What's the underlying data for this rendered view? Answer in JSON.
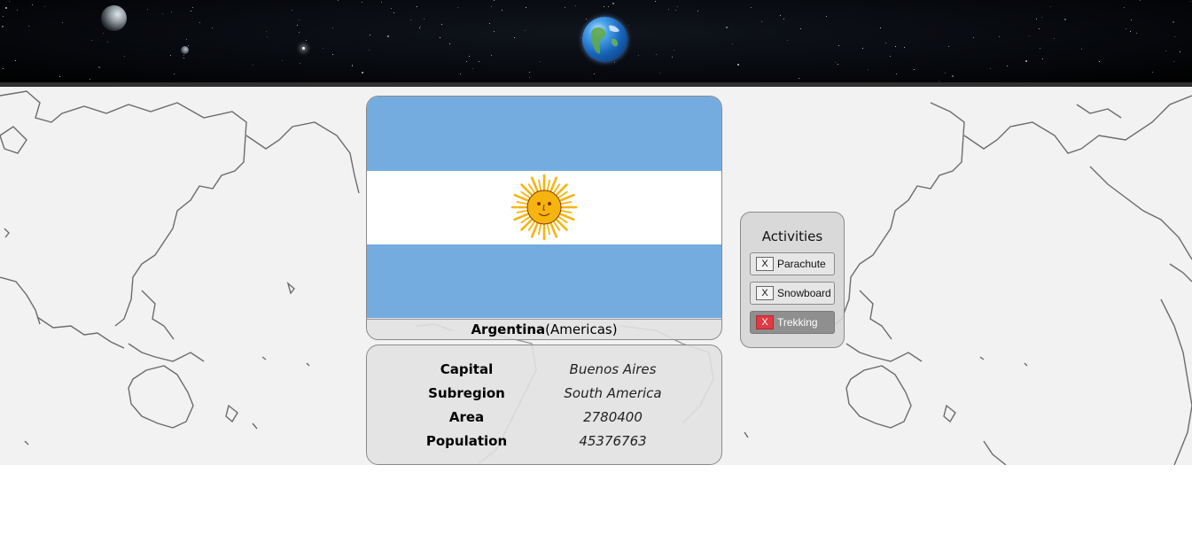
{
  "country": {
    "name": "Argentina",
    "region_text": "(Americas)",
    "flag_colors": {
      "stripe_blue": "#74acdf",
      "stripe_white": "#ffffff",
      "sun": "#f6b40e",
      "sun_outline": "#85340a"
    }
  },
  "details": {
    "rows": [
      {
        "label": "Capital",
        "value": "Buenos Aires"
      },
      {
        "label": "Subregion",
        "value": "South America"
      },
      {
        "label": "Area",
        "value": "2780400"
      },
      {
        "label": "Population",
        "value": "45376763"
      }
    ]
  },
  "activities": {
    "title": "Activities",
    "items": [
      {
        "remove_glyph": "X",
        "label": "Parachute",
        "selected": false
      },
      {
        "remove_glyph": "X",
        "label": "Snowboard",
        "selected": false
      },
      {
        "remove_glyph": "X",
        "label": "Trekking",
        "selected": true
      }
    ]
  },
  "header": {
    "icons": [
      "globe-icon",
      "moon-icon",
      "small-planet-icon"
    ]
  },
  "theme": {
    "map_background": "#f2f2f2",
    "coastline": "#6b6b6b",
    "header_background": "#05070b"
  }
}
